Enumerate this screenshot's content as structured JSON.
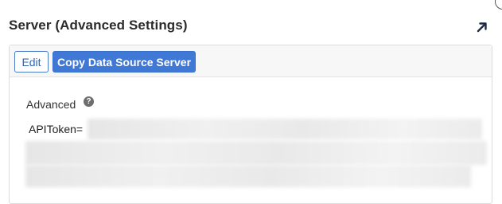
{
  "section": {
    "title": "Server (Advanced Settings)"
  },
  "toolbar": {
    "edit_label": "Edit",
    "copy_label": "Copy Data Source Server"
  },
  "field": {
    "label": "Advanced",
    "help_glyph": "?",
    "value_prefix": "APIToken="
  },
  "icons": {
    "expand": "arrow-up-right-icon",
    "help": "question-circle-icon"
  },
  "colors": {
    "primary": "#3f78d5",
    "title": "#2b2b2b"
  }
}
